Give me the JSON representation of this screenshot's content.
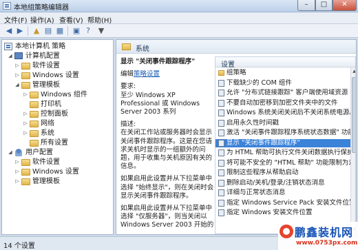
{
  "window": {
    "title": "本地组策略编辑器"
  },
  "menu": [
    {
      "label": "文件(F)"
    },
    {
      "label": "操作(A)"
    },
    {
      "label": "查看(V)"
    },
    {
      "label": "帮助(H)"
    }
  ],
  "toolbar": {
    "icons": [
      "back-arrow-icon",
      "forward-arrow-icon",
      "up-folder-icon",
      "show-hide-tree-icon",
      "export-list-icon",
      "properties-icon",
      "help-icon",
      "filter-icon"
    ]
  },
  "tree": {
    "root": "本地计算机 策略",
    "computer_config": "计算机配置",
    "software_settings": "软件设置",
    "windows_settings": "Windows 设置",
    "admin_templates": "管理模板",
    "windows_components": "Windows 组件",
    "printers": "打印机",
    "control_panel": "控制面板",
    "network": "网络",
    "system": "系统",
    "all_settings": "所有设置",
    "user_config": "用户配置",
    "user_software_settings": "软件设置",
    "user_windows_settings": "Windows 设置",
    "user_admin_templates": "管理模板"
  },
  "detail": {
    "header": "系统",
    "setting_title": "显示 \"关闭事件跟踪程序\"",
    "edit_prefix": "编辑",
    "edit_link": "策略设置",
    "requirements_label": "要求:",
    "requirements_text": "至少 Windows XP Professional 或 Windows Server 2003 系列",
    "description_label": "描述:",
    "description_text": "在关闭工作站或服务器时会显示关闭事件跟踪程序。这是在您请求关机时显示的一组额外的问题，用于收集与关机原因有关的信息。",
    "para2": "如果启用此设置并从下拉菜单中选择 \"始终显示\"，则在关闭时会显示关闭事件跟踪程序。",
    "para3": "如果启用此设置并从下拉菜单中选择 \"仅服务器\"，则当关闭以 Windows Server 2003 开始的"
  },
  "list": {
    "header": "设置",
    "items": [
      {
        "label": "组策略",
        "folder": true
      },
      {
        "label": "下载缺少的 COM 组件"
      },
      {
        "label": "允许 \"分布式链接跟踪\" 客户端使用域资源"
      },
      {
        "label": "不要自动加密移到加密文件夹中的文件"
      },
      {
        "label": "Windows 系统关闭关闭后不关闭系统电源。"
      },
      {
        "label": "启用永久性时间戳"
      },
      {
        "label": "激活 \"关闭事件跟踪程序系统状态数据\" 功能"
      },
      {
        "label": "显示 \"关闭事件跟踪程序\"",
        "selected": true
      },
      {
        "label": "为 HTML 帮助可执行文件关闭数据执行保护"
      },
      {
        "label": "将可能不安全的 \"HTML 帮助\" 功能限制为对指"
      },
      {
        "label": "限制这些程序从帮助启动"
      },
      {
        "label": "删除启动/关机/登录/注销状态消息"
      },
      {
        "label": "详细与正常状态消息"
      },
      {
        "label": "指定 Windows Service Pack 安装文件位置"
      },
      {
        "label": "指定 Windows 安装文件位置"
      }
    ]
  },
  "status": {
    "text": "14 个设置"
  },
  "watermark": {
    "name": "鹏鑫装机网",
    "url": "www.0753px.com"
  }
}
